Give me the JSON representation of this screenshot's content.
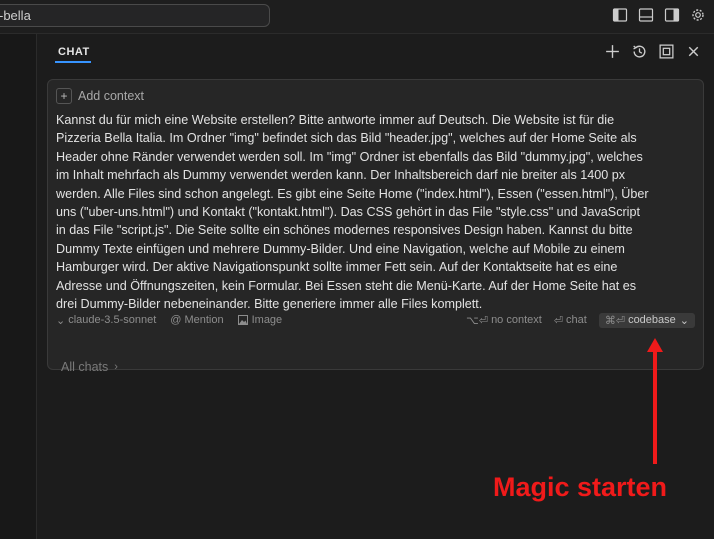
{
  "titlebar": {
    "search_value": "-bella",
    "layout_icons": [
      "toggle-primary-sidebar-icon",
      "toggle-panel-icon",
      "toggle-secondary-sidebar-icon",
      "gear-icon"
    ]
  },
  "panel": {
    "tab_label": "CHAT",
    "actions": [
      "plus-icon",
      "history-icon",
      "maximize-icon",
      "close-icon"
    ]
  },
  "composer": {
    "add_context_label": "Add context",
    "prompt_lines": [
      "Kannst du für mich eine Website erstellen? Bitte antworte immer auf Deutsch. Die Website ist für die",
      "Pizzeria Bella Italia. Im Ordner \"img\" befindet sich das Bild \"header.jpg\", welches auf der Home Seite als",
      "Header ohne Ränder verwendet werden soll. Im \"img\" Ordner ist ebenfalls das Bild \"dummy.jpg\", welches",
      "im Inhalt mehrfach als Dummy verwendet werden kann. Der Inhaltsbereich darf nie breiter als 1400 px",
      "werden. Alle Files sind schon angelegt. Es gibt eine Seite Home (\"index.html\"), Essen (\"essen.html\"), Über",
      "uns (\"uber-uns.html\") und Kontakt (\"kontakt.html\"). Das CSS gehört in das File \"style.css\" und JavaScript",
      "in das File \"script.js\". Die Seite sollte ein schönes modernes responsives Design haben. Kannst du bitte",
      "Dummy Texte einfügen und mehrere Dummy-Bilder. Und eine Navigation, welche auf Mobile zu einem",
      "Hamburger wird. Der aktive Navigationspunkt sollte immer Fett sein. Auf der Kontaktseite hat es eine",
      "Adresse und Öffnungszeiten, kein Formular. Bei Essen steht die Menü-Karte. Auf der Home Seite hat es",
      "drei Dummy-Bilder nebeneinander. Bitte generiere immer alle Files komplett."
    ],
    "model_label": "claude-3.5-sonnet",
    "mention_label": "Mention",
    "image_label": "Image",
    "no_context_shortcut": "⌥⏎",
    "no_context_label": "no context",
    "chat_shortcut": "⏎",
    "chat_label": "chat",
    "codebase_shortcut": "⌘⏎",
    "codebase_label": "codebase"
  },
  "all_chats_label": "All chats",
  "annotation": {
    "text": "Magic starten",
    "color": "#f01a1a"
  },
  "colors": {
    "accent": "#3794ff",
    "background": "#1a1a1a",
    "composer_bg": "#262626"
  }
}
